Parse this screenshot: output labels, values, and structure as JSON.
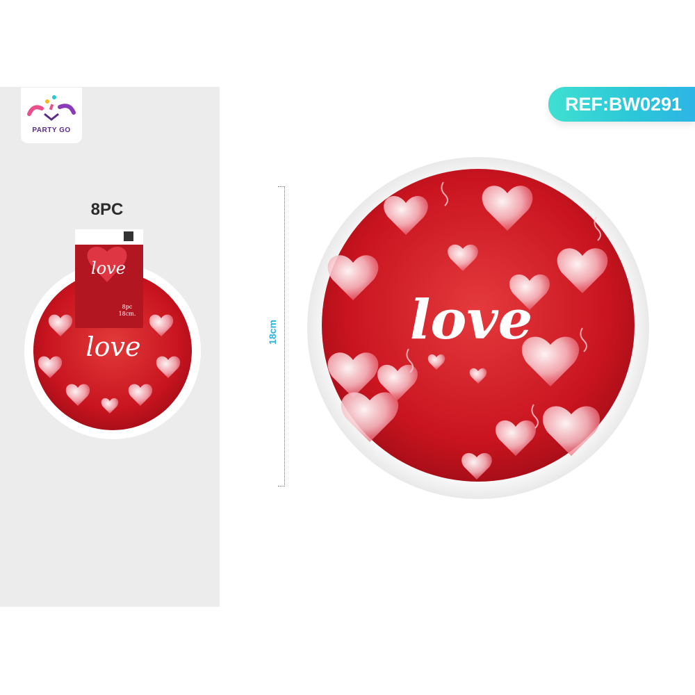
{
  "brand": {
    "name": "PARTY GO"
  },
  "product": {
    "quantity": "8PC",
    "reference": "REF:BW0291",
    "dimension": "18cm",
    "plate_text": "love",
    "package_text": "love",
    "package_qty": "8pc",
    "package_size": "18cm."
  },
  "colors": {
    "plate_red": "#d8202b",
    "badge_teal": "#2bc6d8",
    "panel_gray": "#ececec",
    "brand_purple": "#5a2a8a"
  }
}
